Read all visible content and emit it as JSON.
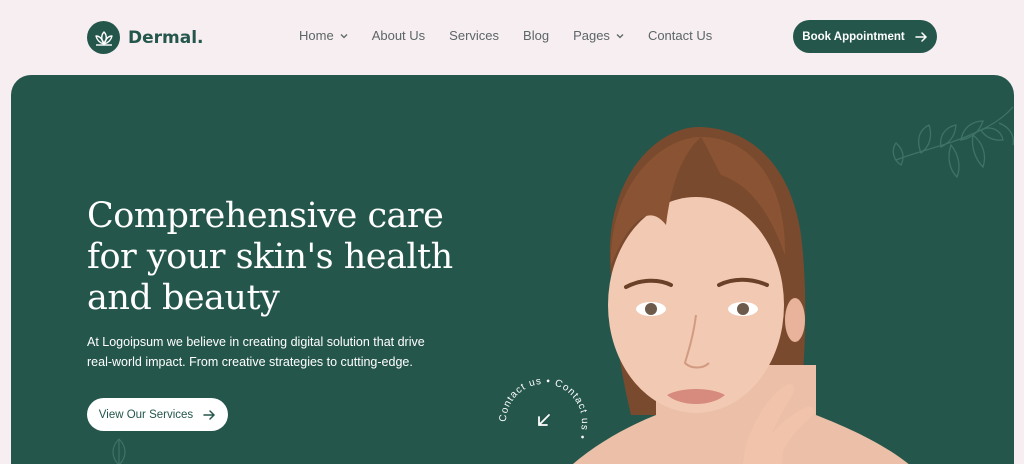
{
  "brand": {
    "name": "Dermal."
  },
  "nav": {
    "items": [
      {
        "label": "Home",
        "dropdown": true
      },
      {
        "label": "About Us",
        "dropdown": false
      },
      {
        "label": "Services",
        "dropdown": false
      },
      {
        "label": "Blog",
        "dropdown": false
      },
      {
        "label": "Pages",
        "dropdown": true
      },
      {
        "label": "Contact Us",
        "dropdown": false
      }
    ],
    "cta_label": "Book Appointment"
  },
  "hero": {
    "title_line1": "Comprehensive care",
    "title_line2": "for your skin's health",
    "title_line3": "and beauty",
    "description_line1": "At Logoipsum we believe in creating digital solution that drive",
    "description_line2": "real-world impact. From creative strategies to cutting-edge.",
    "button_label": "View Our Services",
    "badge_text": "Contact us • Contact us • "
  },
  "colors": {
    "background": "#f6eef1",
    "brand_green": "#24564b",
    "nav_text": "#5d6566",
    "white": "#ffffff"
  }
}
